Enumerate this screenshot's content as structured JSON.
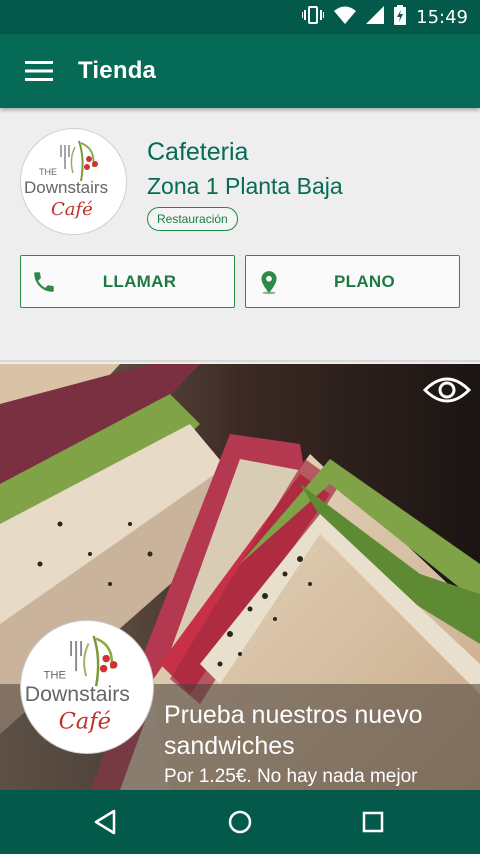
{
  "status_bar": {
    "time": "15:49",
    "icons": [
      "vibrate-icon",
      "wifi-icon",
      "signal-icon",
      "battery-charging-icon"
    ],
    "color": "#045a4a"
  },
  "app_bar": {
    "title": "Tienda",
    "menu_icon": "hamburger-menu-icon",
    "color": "#056a56"
  },
  "store": {
    "logo_text": {
      "line1": "THE",
      "line2": "Downstairs",
      "line3": "Café"
    },
    "name": "Cafeteria",
    "location": "Zona 1 Planta Baja",
    "category": "Restauración",
    "accent": "#1e7a44"
  },
  "actions": {
    "call": {
      "label": "LLAMAR",
      "icon": "phone-icon"
    },
    "map": {
      "label": "PLANO",
      "icon": "map-pin-icon"
    }
  },
  "promo": {
    "view_icon": "eye-icon",
    "title": "Prueba nuestros nuevo sandwiches",
    "subtitle": "Por 1.25€. No hay nada mejor"
  },
  "nav_bar": {
    "back_icon": "back-triangle-icon",
    "home_icon": "home-circle-icon",
    "recents_icon": "recents-square-icon"
  }
}
